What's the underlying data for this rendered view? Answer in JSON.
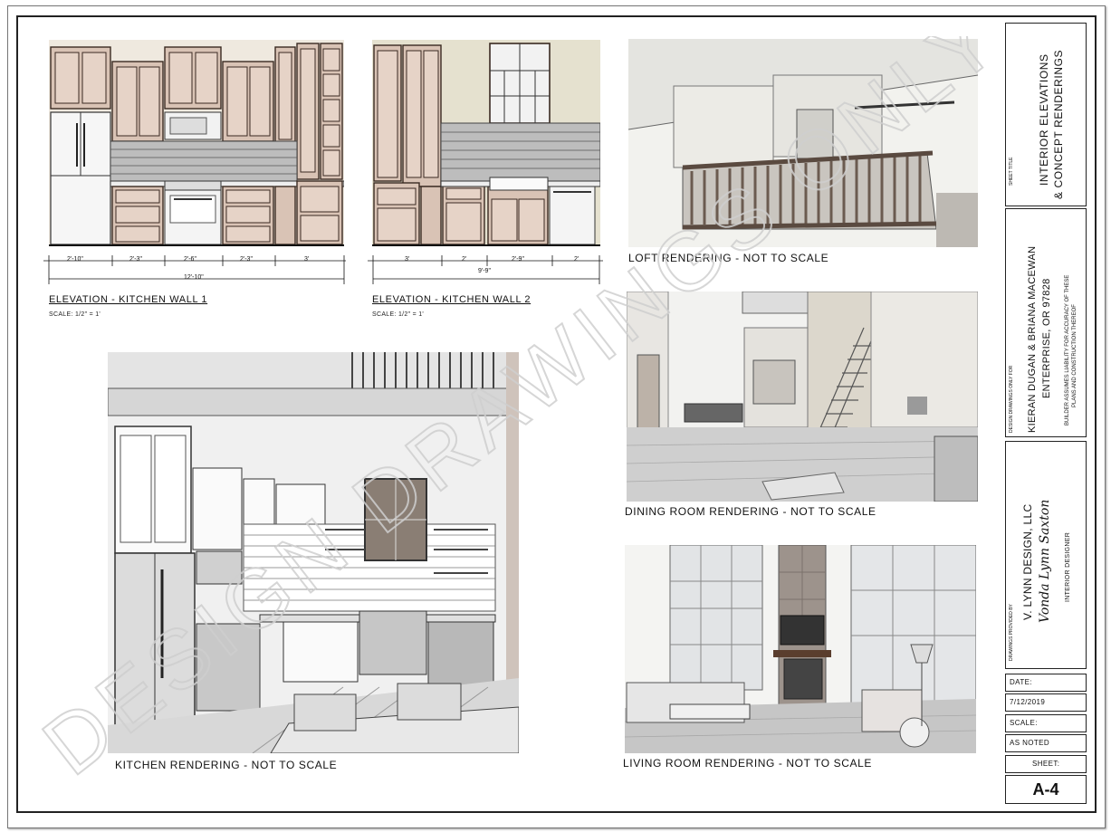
{
  "elevations": [
    {
      "title": "ELEVATION - KITCHEN WALL 1",
      "scale": "SCALE: 1/2\" = 1'",
      "dims": [
        "2'-10\"",
        "2'-3\"",
        "2'-6\"",
        "2'-3\"",
        "3'"
      ],
      "total": "12'-10\""
    },
    {
      "title": "ELEVATION - KITCHEN WALL 2",
      "scale": "SCALE: 1/2\" = 1'",
      "dims": [
        "3'",
        "2'",
        "2'-9\"",
        "2'"
      ],
      "total": "9'-9\""
    }
  ],
  "renderings": {
    "kitchen": "KITCHEN RENDERING - NOT TO SCALE",
    "loft": "LOFT RENDERING - NOT TO SCALE",
    "dining": "DINING ROOM RENDERING - NOT TO SCALE",
    "living": "LIVING ROOM RENDERING - NOT TO SCALE"
  },
  "title_block": {
    "sheet_title_label": "SHEET TITLE",
    "sheet_title_line1": "INTERIOR ELEVATIONS",
    "sheet_title_line2": "& CONCEPT RENDERINGS",
    "design_for_label": "DESIGN DRAWINGS ONLY FOR",
    "client_line1": "KIERAN DUGAN & BRIANA MACEWAN",
    "client_line2": "ENTERPRISE, OR  97828",
    "disclaimer_line1": "BUILDER ASSUMES LIABILITY FOR ACCURACY OF THESE",
    "disclaimer_line2": "PLANS AND CONSTRUCTION THEREOF",
    "provided_by_label": "DRAWINGS PROVIDED BY",
    "company": "V. LYNN DESIGN, LLC",
    "signature": "Vonda Lynn Saxton",
    "designer_role": "INTERIOR DESIGNER",
    "date_label": "DATE:",
    "date_value": "7/12/2019",
    "scale_label": "SCALE:",
    "scale_value": "AS NOTED",
    "sheet_label": "SHEET:",
    "sheet_value": "A-4"
  },
  "watermark": "DESIGN DRAWINGS ONLY"
}
